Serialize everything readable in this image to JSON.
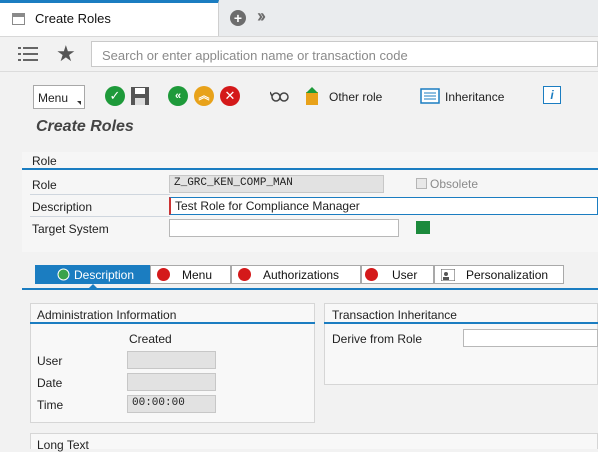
{
  "tab": {
    "title": "Create Roles"
  },
  "search": {
    "placeholder": "Search or enter application name or transaction code"
  },
  "toolbar": {
    "menu_label": "Menu",
    "other_role_label": "Other role",
    "inheritance_label": "Inheritance"
  },
  "page_title": "Create Roles",
  "role_group": {
    "header": "Role",
    "role_label": "Role",
    "role_value": "Z_GRC_KEN_COMP_MAN",
    "obsolete_label": "Obsolete",
    "description_label": "Description",
    "description_value": "Test Role for Compliance Manager",
    "target_label": "Target System",
    "target_value": ""
  },
  "subtabs": [
    {
      "label": "Description",
      "active": true
    },
    {
      "label": "Menu"
    },
    {
      "label": "Authorizations"
    },
    {
      "label": "User"
    },
    {
      "label": "Personalization"
    }
  ],
  "admin": {
    "header": "Administration Information",
    "created_label": "Created",
    "user_label": "User",
    "user_value": "",
    "date_label": "Date",
    "date_value": "",
    "time_label": "Time",
    "time_value": "00:00:00"
  },
  "txn_inheritance": {
    "header": "Transaction Inheritance",
    "derive_label": "Derive from Role",
    "derive_value": ""
  },
  "long_text": {
    "header": "Long Text"
  },
  "colors": {
    "accent": "#1b7dc1",
    "error_red": "#d4191a",
    "ok_green": "#1e9a3a",
    "amber": "#e8a21a",
    "status_green": "#1c8a3c"
  }
}
